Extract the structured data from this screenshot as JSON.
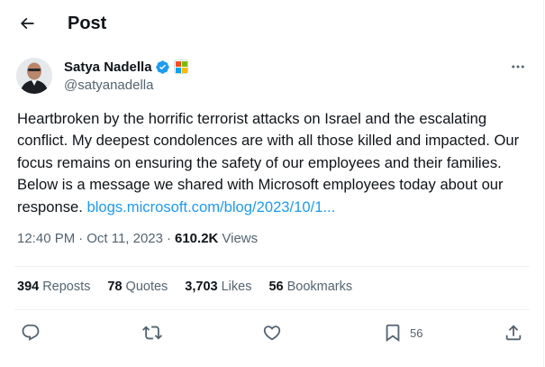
{
  "header": {
    "title": "Post"
  },
  "author": {
    "name": "Satya Nadella",
    "handle": "@satyanadella"
  },
  "tweet": {
    "text": "Heartbroken by the horrific terrorist attacks on Israel and the escalating conflict. My deepest condolences are with all those killed and impacted. Our focus remains on ensuring the safety of our employees and their families. Below is a message we shared with Microsoft employees today about our response. ",
    "link_text": "blogs.microsoft.com/blog/2023/10/1..."
  },
  "meta": {
    "time": "12:40 PM",
    "separator": "·",
    "date": "Oct 11, 2023",
    "views_count": "610.2K",
    "views_label": "Views"
  },
  "stats": {
    "reposts_count": "394",
    "reposts_label": "Reposts",
    "quotes_count": "78",
    "quotes_label": "Quotes",
    "likes_count": "3,703",
    "likes_label": "Likes",
    "bookmarks_count": "56",
    "bookmarks_label": "Bookmarks"
  },
  "actions": {
    "bookmark_count": "56"
  },
  "colors": {
    "text": "#0f1419",
    "secondary": "#536471",
    "link": "#1d9bf0",
    "verified": "#1d9bf0",
    "divider": "#eff3f4"
  },
  "icons": [
    "back-arrow-icon",
    "verified-badge-icon",
    "affiliation-badge-icon",
    "more-icon",
    "reply-icon",
    "repost-icon",
    "like-icon",
    "bookmark-icon",
    "share-icon"
  ]
}
